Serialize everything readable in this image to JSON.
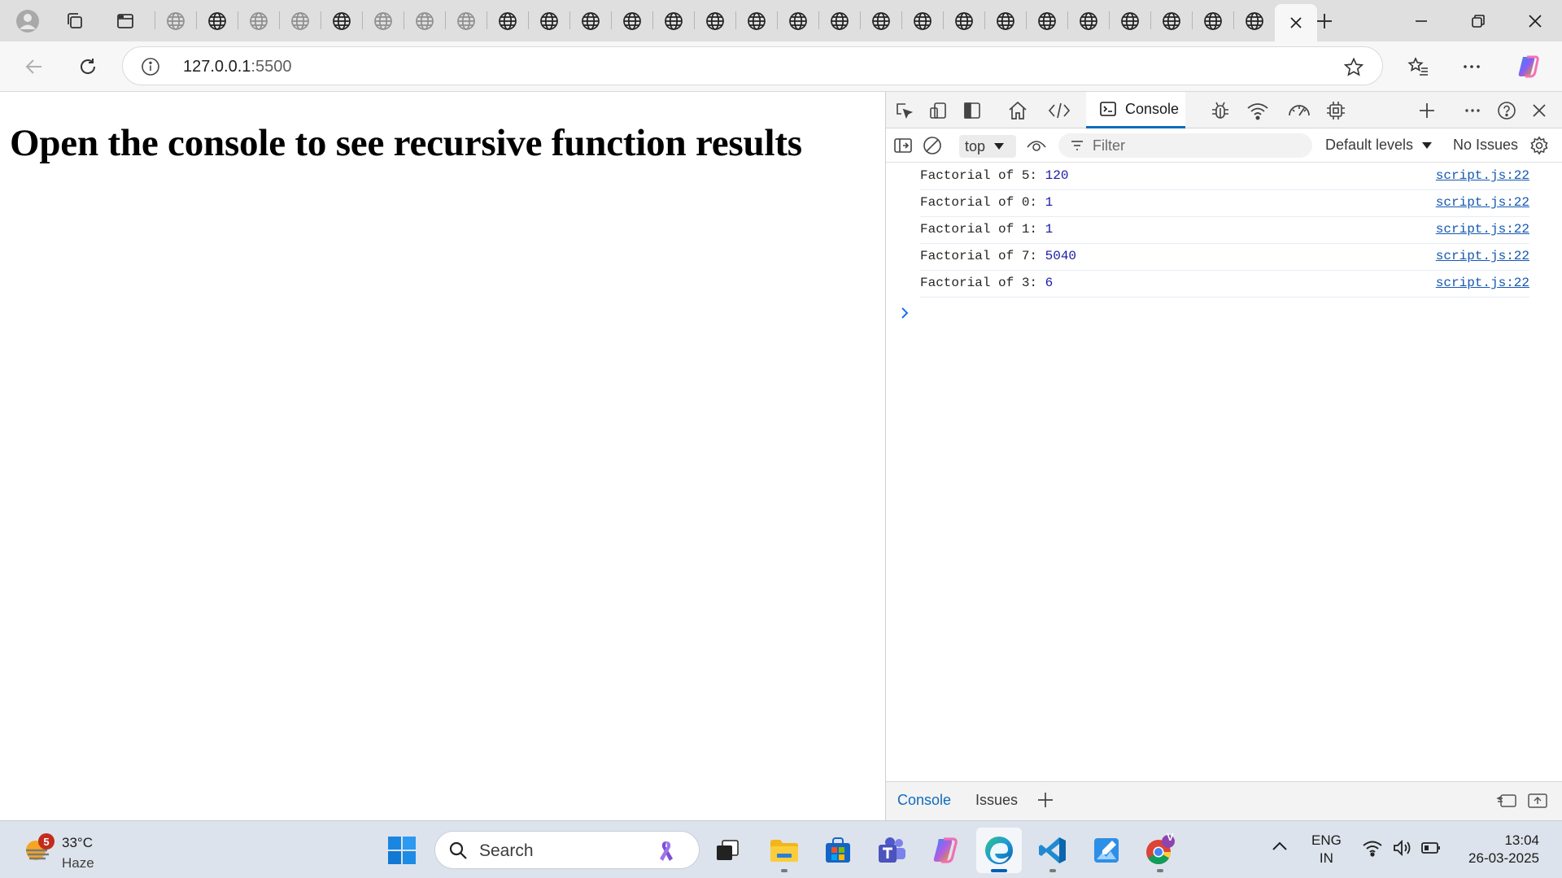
{
  "browser": {
    "tab_count": 27,
    "faded_tabs": [
      0,
      2,
      3,
      5,
      6,
      7
    ],
    "active_tab_close": "×",
    "url_host": "127.0.0.1",
    "url_port": ":5500"
  },
  "page": {
    "heading": "Open the console to see recursive function results"
  },
  "devtools": {
    "active_tab": "Console",
    "context": "top",
    "filter_placeholder": "Filter",
    "levels": "Default levels",
    "issues": "No Issues",
    "logs": [
      {
        "label": "Factorial of 5: ",
        "value": "120",
        "source": "script.js:22"
      },
      {
        "label": "Factorial of 0: ",
        "value": "1",
        "source": "script.js:22"
      },
      {
        "label": "Factorial of 1: ",
        "value": "1",
        "source": "script.js:22"
      },
      {
        "label": "Factorial of 7: ",
        "value": "5040",
        "source": "script.js:22"
      },
      {
        "label": "Factorial of 3: ",
        "value": "6",
        "source": "script.js:22"
      }
    ],
    "drawer_tabs": [
      "Console",
      "Issues"
    ]
  },
  "taskbar": {
    "weather": {
      "temp": "33°C",
      "condition": "Haze",
      "badge": "5"
    },
    "search_label": "Search",
    "pinned": [
      "file-explorer",
      "microsoft-store",
      "teams",
      "copilot",
      "edge",
      "vscode",
      "paint",
      "chrome"
    ],
    "chrome_profile_letter": "V",
    "language": {
      "line1": "ENG",
      "line2": "IN"
    },
    "clock": {
      "time": "13:04",
      "date": "26-03-2025"
    }
  },
  "colors": {
    "accent": "#0f6cbd",
    "console_number": "#1a1aa6",
    "link": "#1558b0"
  }
}
